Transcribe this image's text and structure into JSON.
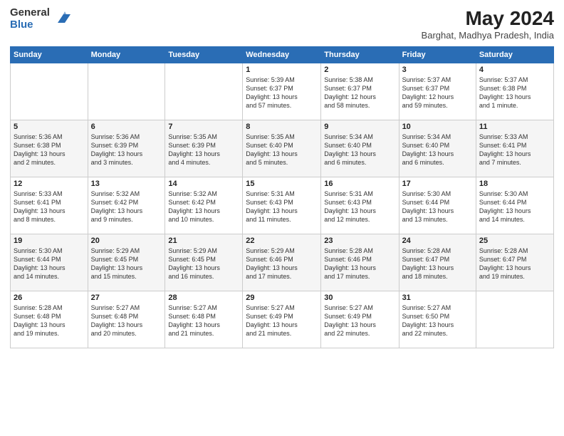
{
  "header": {
    "logo_general": "General",
    "logo_blue": "Blue",
    "main_title": "May 2024",
    "subtitle": "Barghat, Madhya Pradesh, India"
  },
  "calendar": {
    "days_of_week": [
      "Sunday",
      "Monday",
      "Tuesday",
      "Wednesday",
      "Thursday",
      "Friday",
      "Saturday"
    ],
    "weeks": [
      [
        {
          "day": "",
          "info": ""
        },
        {
          "day": "",
          "info": ""
        },
        {
          "day": "",
          "info": ""
        },
        {
          "day": "1",
          "info": "Sunrise: 5:39 AM\nSunset: 6:37 PM\nDaylight: 13 hours\nand 57 minutes."
        },
        {
          "day": "2",
          "info": "Sunrise: 5:38 AM\nSunset: 6:37 PM\nDaylight: 12 hours\nand 58 minutes."
        },
        {
          "day": "3",
          "info": "Sunrise: 5:37 AM\nSunset: 6:37 PM\nDaylight: 12 hours\nand 59 minutes."
        },
        {
          "day": "4",
          "info": "Sunrise: 5:37 AM\nSunset: 6:38 PM\nDaylight: 13 hours\nand 1 minute."
        }
      ],
      [
        {
          "day": "5",
          "info": "Sunrise: 5:36 AM\nSunset: 6:38 PM\nDaylight: 13 hours\nand 2 minutes."
        },
        {
          "day": "6",
          "info": "Sunrise: 5:36 AM\nSunset: 6:39 PM\nDaylight: 13 hours\nand 3 minutes."
        },
        {
          "day": "7",
          "info": "Sunrise: 5:35 AM\nSunset: 6:39 PM\nDaylight: 13 hours\nand 4 minutes."
        },
        {
          "day": "8",
          "info": "Sunrise: 5:35 AM\nSunset: 6:40 PM\nDaylight: 13 hours\nand 5 minutes."
        },
        {
          "day": "9",
          "info": "Sunrise: 5:34 AM\nSunset: 6:40 PM\nDaylight: 13 hours\nand 6 minutes."
        },
        {
          "day": "10",
          "info": "Sunrise: 5:34 AM\nSunset: 6:40 PM\nDaylight: 13 hours\nand 6 minutes."
        },
        {
          "day": "11",
          "info": "Sunrise: 5:33 AM\nSunset: 6:41 PM\nDaylight: 13 hours\nand 7 minutes."
        }
      ],
      [
        {
          "day": "12",
          "info": "Sunrise: 5:33 AM\nSunset: 6:41 PM\nDaylight: 13 hours\nand 8 minutes."
        },
        {
          "day": "13",
          "info": "Sunrise: 5:32 AM\nSunset: 6:42 PM\nDaylight: 13 hours\nand 9 minutes."
        },
        {
          "day": "14",
          "info": "Sunrise: 5:32 AM\nSunset: 6:42 PM\nDaylight: 13 hours\nand 10 minutes."
        },
        {
          "day": "15",
          "info": "Sunrise: 5:31 AM\nSunset: 6:43 PM\nDaylight: 13 hours\nand 11 minutes."
        },
        {
          "day": "16",
          "info": "Sunrise: 5:31 AM\nSunset: 6:43 PM\nDaylight: 13 hours\nand 12 minutes."
        },
        {
          "day": "17",
          "info": "Sunrise: 5:30 AM\nSunset: 6:44 PM\nDaylight: 13 hours\nand 13 minutes."
        },
        {
          "day": "18",
          "info": "Sunrise: 5:30 AM\nSunset: 6:44 PM\nDaylight: 13 hours\nand 14 minutes."
        }
      ],
      [
        {
          "day": "19",
          "info": "Sunrise: 5:30 AM\nSunset: 6:44 PM\nDaylight: 13 hours\nand 14 minutes."
        },
        {
          "day": "20",
          "info": "Sunrise: 5:29 AM\nSunset: 6:45 PM\nDaylight: 13 hours\nand 15 minutes."
        },
        {
          "day": "21",
          "info": "Sunrise: 5:29 AM\nSunset: 6:45 PM\nDaylight: 13 hours\nand 16 minutes."
        },
        {
          "day": "22",
          "info": "Sunrise: 5:29 AM\nSunset: 6:46 PM\nDaylight: 13 hours\nand 17 minutes."
        },
        {
          "day": "23",
          "info": "Sunrise: 5:28 AM\nSunset: 6:46 PM\nDaylight: 13 hours\nand 17 minutes."
        },
        {
          "day": "24",
          "info": "Sunrise: 5:28 AM\nSunset: 6:47 PM\nDaylight: 13 hours\nand 18 minutes."
        },
        {
          "day": "25",
          "info": "Sunrise: 5:28 AM\nSunset: 6:47 PM\nDaylight: 13 hours\nand 19 minutes."
        }
      ],
      [
        {
          "day": "26",
          "info": "Sunrise: 5:28 AM\nSunset: 6:48 PM\nDaylight: 13 hours\nand 19 minutes."
        },
        {
          "day": "27",
          "info": "Sunrise: 5:27 AM\nSunset: 6:48 PM\nDaylight: 13 hours\nand 20 minutes."
        },
        {
          "day": "28",
          "info": "Sunrise: 5:27 AM\nSunset: 6:48 PM\nDaylight: 13 hours\nand 21 minutes."
        },
        {
          "day": "29",
          "info": "Sunrise: 5:27 AM\nSunset: 6:49 PM\nDaylight: 13 hours\nand 21 minutes."
        },
        {
          "day": "30",
          "info": "Sunrise: 5:27 AM\nSunset: 6:49 PM\nDaylight: 13 hours\nand 22 minutes."
        },
        {
          "day": "31",
          "info": "Sunrise: 5:27 AM\nSunset: 6:50 PM\nDaylight: 13 hours\nand 22 minutes."
        },
        {
          "day": "",
          "info": ""
        }
      ]
    ]
  }
}
